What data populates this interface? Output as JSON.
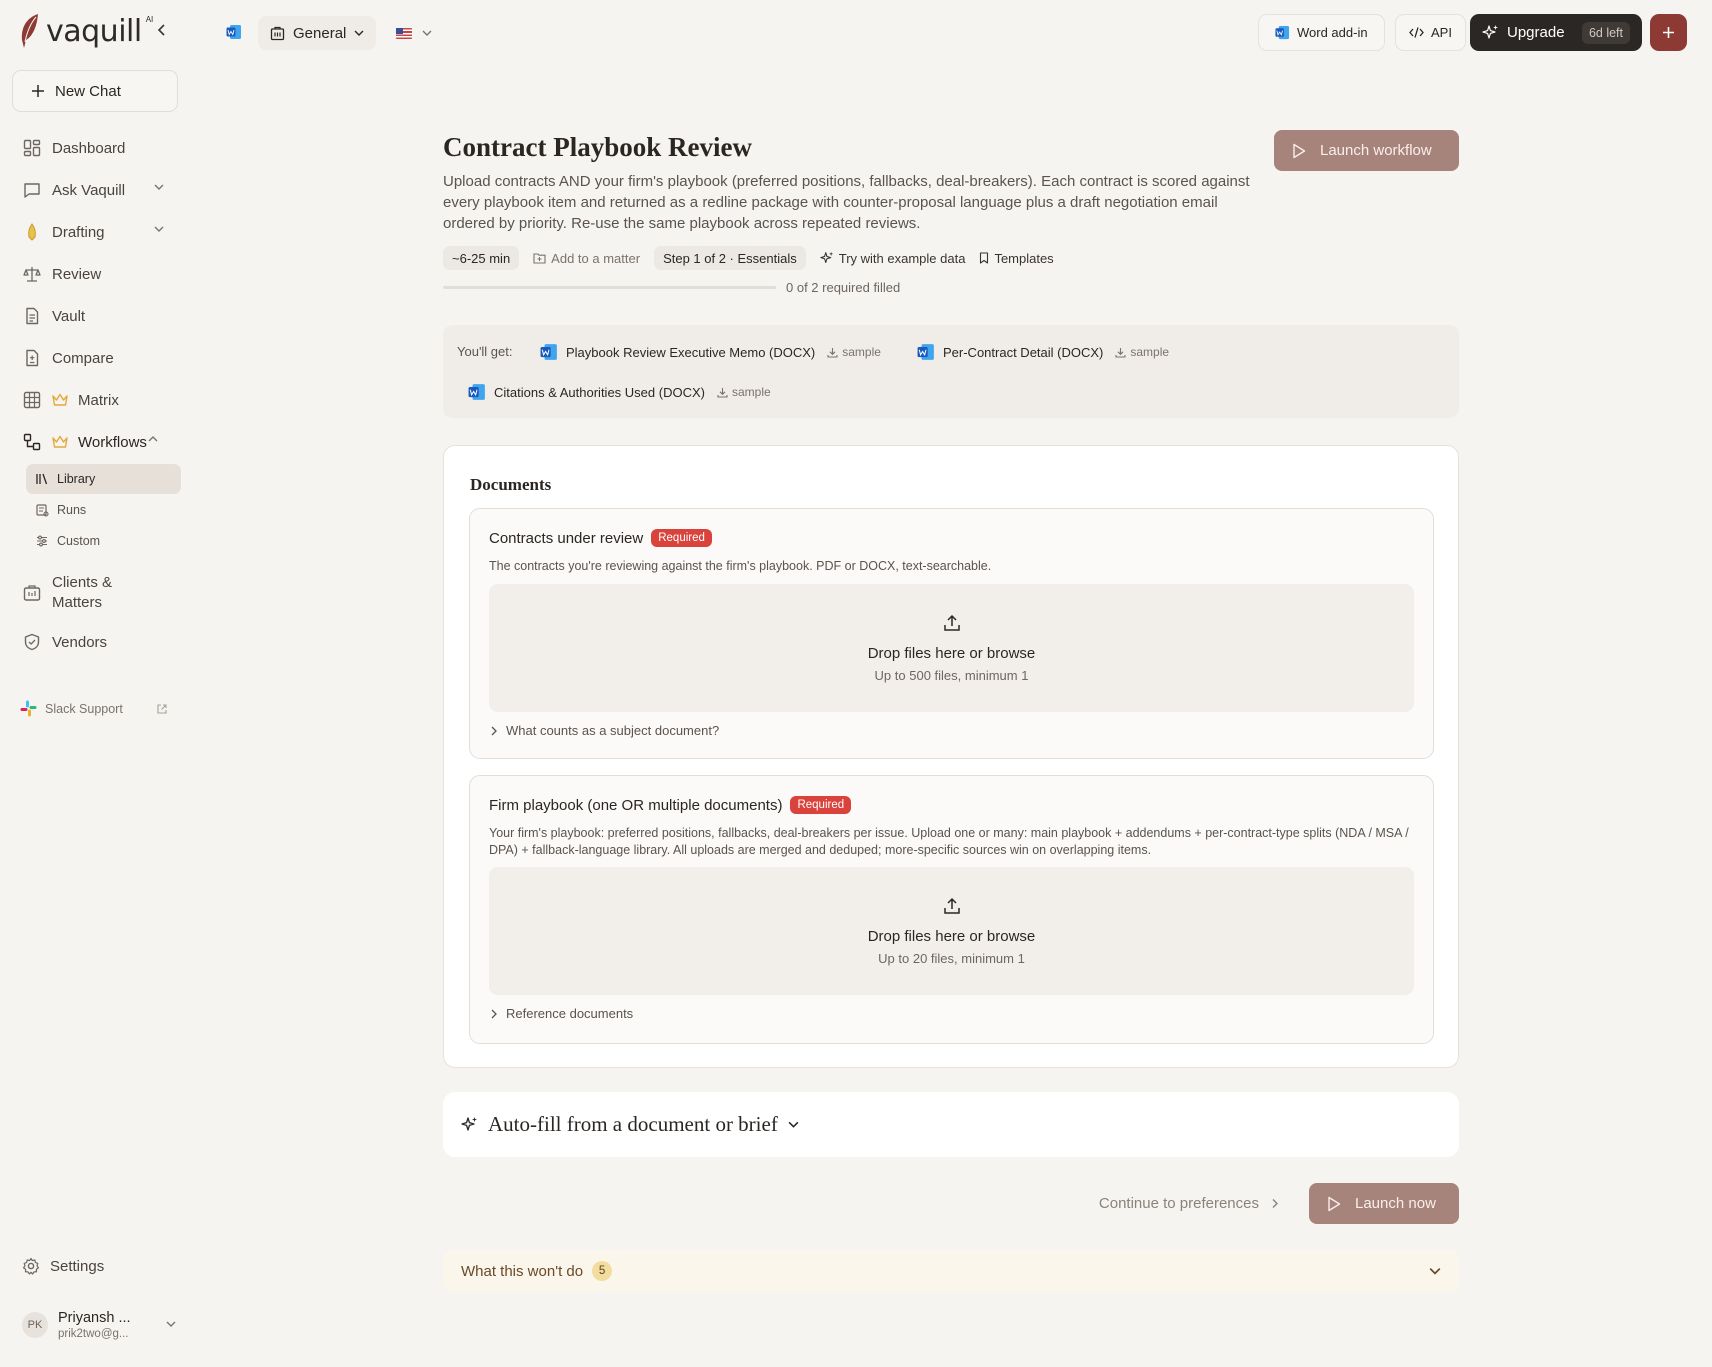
{
  "brand": {
    "name": "vaquill",
    "suffix": "AI"
  },
  "sidebar": {
    "new_chat": "New Chat",
    "items": [
      {
        "label": "Dashboard",
        "icon": "dashboard-icon"
      },
      {
        "label": "Ask Vaquill",
        "icon": "chat-icon"
      },
      {
        "label": "Drafting",
        "icon": "pen-nib-icon"
      },
      {
        "label": "Review",
        "icon": "scale-icon"
      },
      {
        "label": "Vault",
        "icon": "document-icon"
      },
      {
        "label": "Compare",
        "icon": "compare-icon"
      },
      {
        "label": "Matrix",
        "icon": "grid-icon"
      },
      {
        "label": "Workflows",
        "icon": "workflow-icon"
      }
    ],
    "workflow_sub": [
      {
        "label": "Library",
        "icon": "library-icon"
      },
      {
        "label": "Runs",
        "icon": "runs-icon"
      },
      {
        "label": "Custom",
        "icon": "sliders-icon"
      }
    ],
    "clients": "Clients & Matters",
    "vendors": "Vendors",
    "slack": "Slack Support",
    "settings": "Settings",
    "user": {
      "initials": "PK",
      "name": "Priyansh ...",
      "email": "prik2two@g..."
    }
  },
  "topbar": {
    "workspace": "General",
    "word_addin": "Word add-in",
    "api": "API",
    "upgrade": "Upgrade",
    "days_left": "6d left"
  },
  "page": {
    "title": "Contract Playbook Review",
    "launch_workflow": "Launch workflow",
    "description": "Upload contracts AND your firm's playbook (preferred positions, fallbacks, deal-breakers). Each contract is scored against every playbook item and returned as a redline package with counter-proposal language plus a draft negotiation email ordered by priority. Re-use the same playbook across repeated reviews.",
    "duration": "~6-25 min",
    "add_to_matter": "Add to a matter",
    "step": "Step 1 of 2 · Essentials",
    "try_example": "Try with example data",
    "templates": "Templates",
    "progress_fraction": 0,
    "progress_text": "0 of 2 required filled"
  },
  "deliverables": {
    "label": "You'll get:",
    "sample_label": "sample",
    "items": [
      "Playbook Review Executive Memo (DOCX)",
      "Per-Contract Detail (DOCX)",
      "Citations & Authorities Used (DOCX)"
    ]
  },
  "documents": {
    "title": "Documents",
    "blocks": [
      {
        "title": "Contracts under review",
        "badge": "Required",
        "description": "The contracts you're reviewing against the firm's playbook. PDF or DOCX, text-searchable.",
        "drop_title": "Drop files here or browse",
        "drop_sub": "Up to 500 files, minimum 1",
        "more": "What counts as a subject document?"
      },
      {
        "title": "Firm playbook (one OR multiple documents)",
        "badge": "Required",
        "description": "Your firm's playbook: preferred positions, fallbacks, deal-breakers per issue. Upload one or many: main playbook + addendums + per-contract-type splits (NDA / MSA / DPA) + fallback-language library. All uploads are merged and deduped; more-specific sources win on overlapping items.",
        "drop_title": "Drop files here or browse",
        "drop_sub": "Up to 20 files, minimum 1",
        "more": "Reference documents"
      }
    ]
  },
  "autofill": {
    "title": "Auto-fill from a document or brief"
  },
  "footer": {
    "continue": "Continue to preferences",
    "launch_now": "Launch now",
    "wont_do": "What this won't do",
    "wont_do_count": "5"
  },
  "colors": {
    "accent": "#a6837b",
    "brand_red": "#8d3a34",
    "required": "#d9433c",
    "background": "#f6f4f1"
  }
}
